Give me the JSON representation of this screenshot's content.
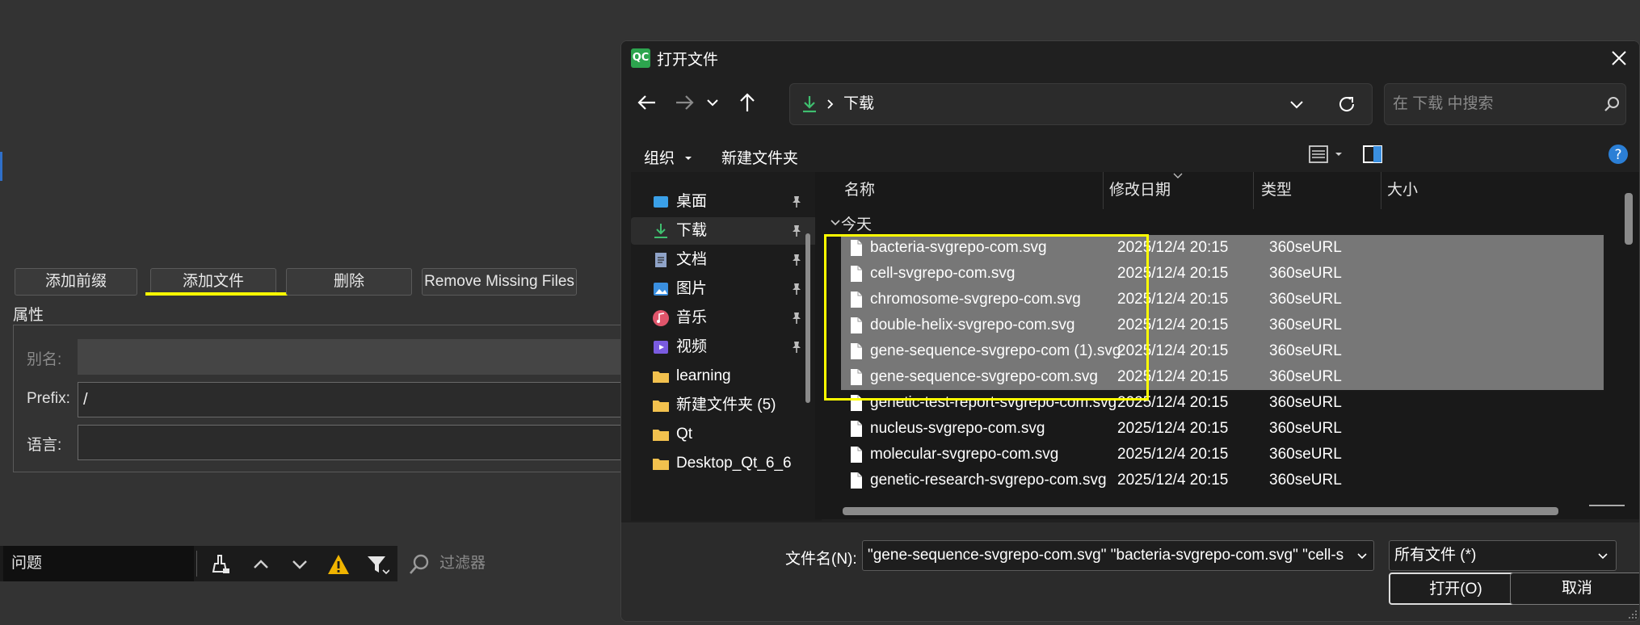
{
  "editor": {
    "buttons": [
      "添加前缀",
      "添加文件",
      "删除",
      "Remove Missing Files"
    ],
    "props_title": "属性",
    "props": [
      {
        "label": "别名:",
        "value": "",
        "disabled": true
      },
      {
        "label": "Prefix:",
        "value": "/",
        "disabled": false
      },
      {
        "label": "语言:",
        "value": "",
        "disabled": false
      }
    ],
    "issues_label": "问题",
    "filter_placeholder": "过滤器"
  },
  "dialog": {
    "logo": "QC",
    "title": "打开文件",
    "address": "下载",
    "search_placeholder": "在 下载 中搜索",
    "organize_label": "组织",
    "new_folder_label": "新建文件夹",
    "sidebar": [
      {
        "label": "桌面",
        "icon": "desktop-icon",
        "pinned": true,
        "selected": false,
        "color": "#3aa0e8"
      },
      {
        "label": "下载",
        "icon": "download-icon",
        "pinned": true,
        "selected": true,
        "color": "#3fbf6f"
      },
      {
        "label": "文档",
        "icon": "document-icon",
        "pinned": true,
        "selected": false,
        "color": "#8fa3c8"
      },
      {
        "label": "图片",
        "icon": "picture-icon",
        "pinned": true,
        "selected": false,
        "color": "#3a8fe0"
      },
      {
        "label": "音乐",
        "icon": "music-icon",
        "pinned": true,
        "selected": false,
        "color": "#e0556b"
      },
      {
        "label": "视频",
        "icon": "video-icon",
        "pinned": true,
        "selected": false,
        "color": "#7a5be0"
      },
      {
        "label": "learning",
        "icon": "folder-icon",
        "pinned": false,
        "selected": false,
        "color": "#f2c14e"
      },
      {
        "label": "新建文件夹 (5)",
        "icon": "folder-icon",
        "pinned": false,
        "selected": false,
        "color": "#f2c14e"
      },
      {
        "label": "Qt",
        "icon": "folder-icon",
        "pinned": false,
        "selected": false,
        "color": "#f2c14e"
      },
      {
        "label": "Desktop_Qt_6_6",
        "icon": "folder-icon",
        "pinned": false,
        "selected": false,
        "color": "#f2c14e"
      }
    ],
    "columns": {
      "name": "名称",
      "date": "修改日期",
      "type": "类型",
      "size": "大小"
    },
    "group_label": "今天",
    "files": [
      {
        "name": "bacteria-svgrepo-com.svg",
        "date": "2025/12/4 20:15",
        "type": "360seURL",
        "selected": true
      },
      {
        "name": "cell-svgrepo-com.svg",
        "date": "2025/12/4 20:15",
        "type": "360seURL",
        "selected": true
      },
      {
        "name": "chromosome-svgrepo-com.svg",
        "date": "2025/12/4 20:15",
        "type": "360seURL",
        "selected": true
      },
      {
        "name": "double-helix-svgrepo-com.svg",
        "date": "2025/12/4 20:15",
        "type": "360seURL",
        "selected": true
      },
      {
        "name": "gene-sequence-svgrepo-com (1).svg",
        "date": "2025/12/4 20:15",
        "type": "360seURL",
        "selected": true
      },
      {
        "name": "gene-sequence-svgrepo-com.svg",
        "date": "2025/12/4 20:15",
        "type": "360seURL",
        "selected": true
      },
      {
        "name": "genetic-test-report-svgrepo-com.svg",
        "date": "2025/12/4 20:15",
        "type": "360seURL",
        "selected": false
      },
      {
        "name": "nucleus-svgrepo-com.svg",
        "date": "2025/12/4 20:15",
        "type": "360seURL",
        "selected": false
      },
      {
        "name": "molecular-svgrepo-com.svg",
        "date": "2025/12/4 20:15",
        "type": "360seURL",
        "selected": false
      },
      {
        "name": "genetic-research-svgrepo-com.svg",
        "date": "2025/12/4 20:15",
        "type": "360seURL",
        "selected": false
      }
    ],
    "filename_label": "文件名(N):",
    "filename_value": "\"gene-sequence-svgrepo-com.svg\" \"bacteria-svgrepo-com.svg\" \"cell-s",
    "filetype_value": "所有文件 (*)",
    "open_label": "打开(O)",
    "cancel_label": "取消"
  },
  "colors": {
    "accent_highlight": "#ffff00",
    "selection": "#777777",
    "qc_green": "#2da44e"
  }
}
